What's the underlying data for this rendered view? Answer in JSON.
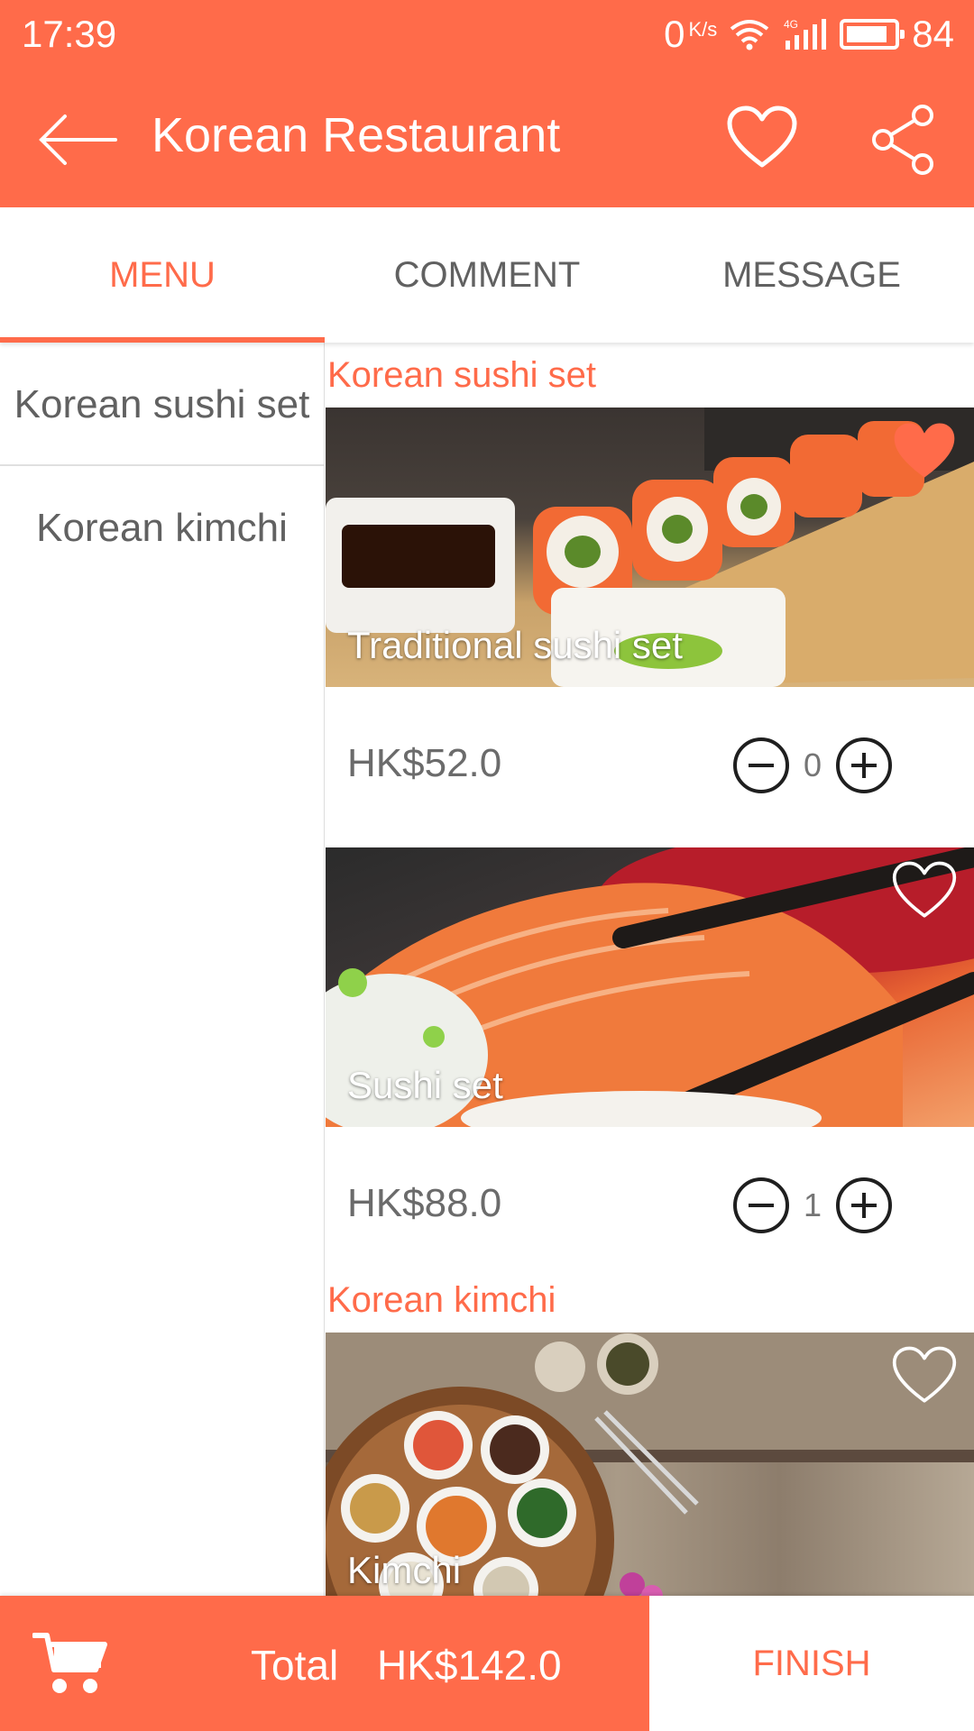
{
  "status": {
    "time": "17:39",
    "speed": "0",
    "speed_unit": "K/s",
    "network": "4G",
    "battery": "84"
  },
  "appbar": {
    "title": "Korean Restaurant",
    "back_icon": "arrow-left-icon",
    "fav_icon": "heart-outline-icon",
    "share_icon": "share-icon"
  },
  "tabs": [
    {
      "label": "MENU",
      "active": true
    },
    {
      "label": "COMMENT",
      "active": false
    },
    {
      "label": "MESSAGE",
      "active": false
    }
  ],
  "categories": [
    "Korean sushi set",
    "Korean kimchi"
  ],
  "sections": [
    {
      "title": "Korean sushi set",
      "items": [
        {
          "name": "Traditional sushi set",
          "price": "HK$52.0",
          "qty": "0",
          "favorited": true
        },
        {
          "name": "Sushi set",
          "price": "HK$88.0",
          "qty": "1",
          "favorited": false
        }
      ]
    },
    {
      "title": "Korean kimchi",
      "items": [
        {
          "name": "Kimchi",
          "favorited": false
        }
      ]
    }
  ],
  "bottom": {
    "total_label": "Total",
    "total_value": "HK$142.0",
    "finish_label": "FINISH"
  },
  "colors": {
    "accent": "#ff6b4a",
    "text_gray": "#616161"
  }
}
